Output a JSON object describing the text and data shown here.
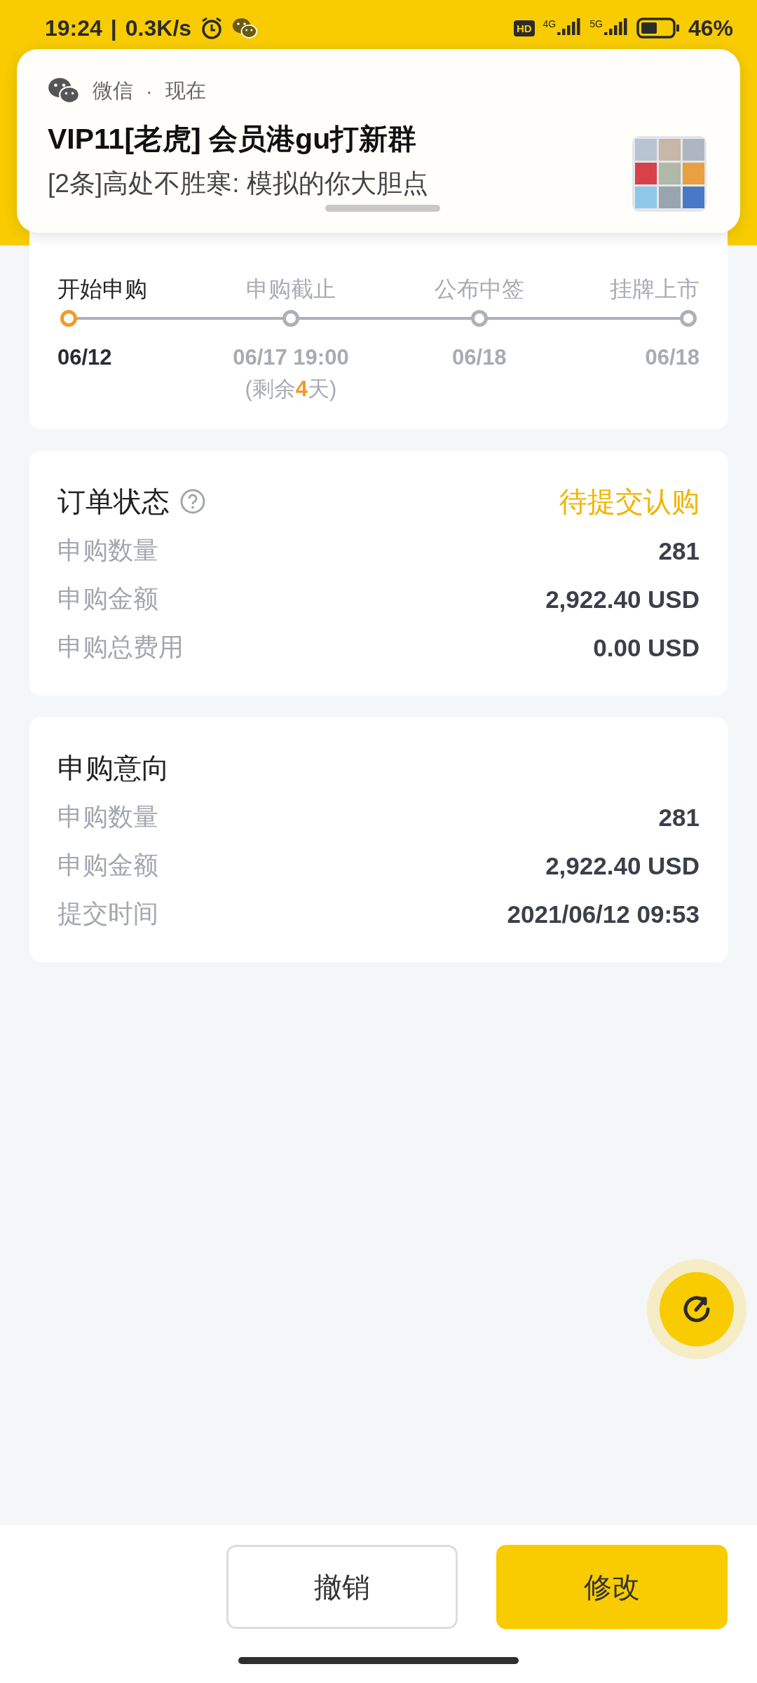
{
  "status_bar": {
    "time": "19:24",
    "divider": "|",
    "speed": "0.3K/s",
    "hd": "HD",
    "sim1": "4G",
    "sim2": "5G",
    "battery": "46%"
  },
  "notification": {
    "app": "微信",
    "separator": "·",
    "time": "现在",
    "title": "VIP11[老虎] 会员港gu打新群",
    "message": "[2条]高处不胜寒: 模拟的你大胆点"
  },
  "timeline": [
    {
      "label": "开始申购",
      "date": "06/12",
      "active": true
    },
    {
      "label": "申购截止",
      "date": "06/17 19:00",
      "active": false,
      "note": [
        {
          "text": "(剩余",
          "highlight": false
        },
        {
          "text": "4",
          "highlight": true
        },
        {
          "text": "天)",
          "highlight": false
        }
      ]
    },
    {
      "label": "公布中签",
      "date": "06/18",
      "active": false
    },
    {
      "label": "挂牌上市",
      "date": "06/18",
      "active": false
    }
  ],
  "order_status": {
    "title": "订单状态",
    "status": "待提交认购",
    "rows": [
      {
        "label": "申购数量",
        "value": "281"
      },
      {
        "label": "申购金额",
        "value": "2,922.40 USD"
      },
      {
        "label": "申购总费用",
        "value": "0.00 USD"
      }
    ]
  },
  "intent": {
    "title": "申购意向",
    "rows": [
      {
        "label": "申购数量",
        "value": "281"
      },
      {
        "label": "申购金额",
        "value": "2,922.40 USD"
      },
      {
        "label": "提交时间",
        "value": "2021/06/12 09:53"
      }
    ]
  },
  "buttons": [
    {
      "label": "撤销",
      "kind": "outline"
    },
    {
      "label": "修改",
      "kind": "primary"
    }
  ]
}
